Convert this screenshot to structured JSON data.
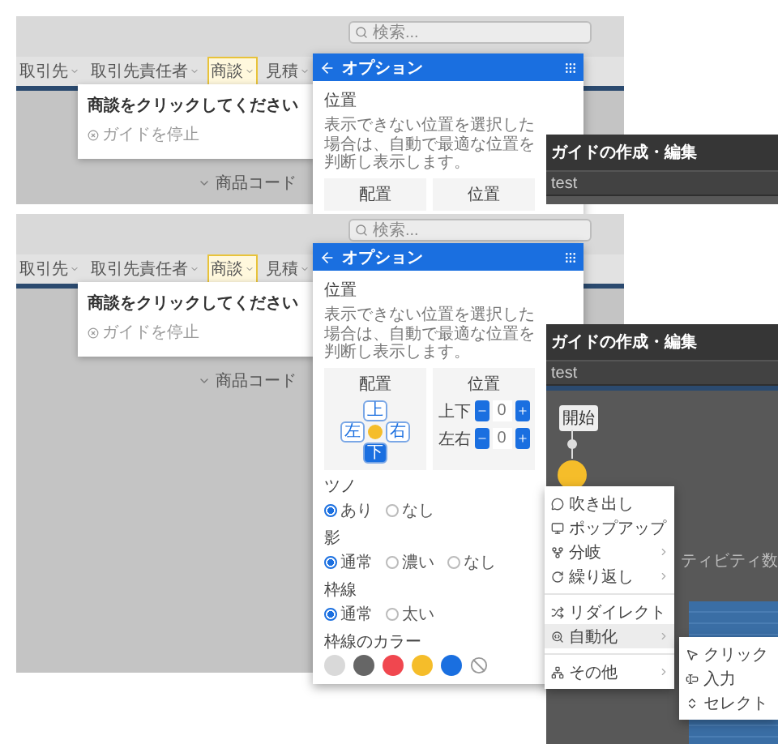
{
  "screens": [
    {
      "search": {
        "placeholder": "検索..."
      },
      "nav": [
        {
          "label": "取引先",
          "selected": false
        },
        {
          "label": "取引先責任者",
          "selected": false
        },
        {
          "label": "商談",
          "selected": true
        },
        {
          "label": "見積",
          "selected": false
        }
      ],
      "tooltip": {
        "title": "商談をクリックしてください",
        "stop_link": "ガイドを停止"
      },
      "column_header": "商品コード",
      "options": {
        "title": "オプション",
        "position": {
          "title": "位置",
          "description": "表示できない位置を選択した場合は、自動で最適な位置を判断し表示します。",
          "placement_label": "配置",
          "offset_label": "位置"
        }
      },
      "guide_panel": {
        "title": "ガイドの作成・編集",
        "name": "test"
      }
    },
    {
      "search": {
        "placeholder": "検索..."
      },
      "nav": [
        {
          "label": "取引先",
          "selected": false
        },
        {
          "label": "取引先責任者",
          "selected": false
        },
        {
          "label": "商談",
          "selected": true
        },
        {
          "label": "見積",
          "selected": false
        }
      ],
      "tooltip": {
        "title": "商談をクリックしてください",
        "stop_link": "ガイドを停止"
      },
      "column_header": "商品コード",
      "options": {
        "title": "オプション",
        "position": {
          "title": "位置",
          "description": "表示できない位置を選択した場合は、自動で最適な位置を判断し表示します。",
          "placement_label": "配置",
          "offset_label": "位置",
          "placement": [
            {
              "kind": "top",
              "label": "上",
              "selected": false
            },
            {
              "kind": "left",
              "label": "左",
              "selected": false
            },
            {
              "kind": "right",
              "label": "右",
              "selected": false
            },
            {
              "kind": "bottom",
              "label": "下",
              "selected": true
            }
          ],
          "offsets": [
            {
              "label": "上下",
              "value": "0"
            },
            {
              "label": "左右",
              "value": "0"
            }
          ]
        },
        "radio_groups": [
          {
            "title": "ツノ",
            "options": [
              {
                "label": "あり",
                "selected": true
              },
              {
                "label": "なし",
                "selected": false
              }
            ]
          },
          {
            "title": "影",
            "options": [
              {
                "label": "通常",
                "selected": true
              },
              {
                "label": "濃い",
                "selected": false
              },
              {
                "label": "なし",
                "selected": false
              }
            ]
          },
          {
            "title": "枠線",
            "options": [
              {
                "label": "通常",
                "selected": true
              },
              {
                "label": "太い",
                "selected": false
              }
            ]
          }
        ],
        "border_color": {
          "title": "枠線のカラー",
          "swatches": [
            {
              "kind": "color",
              "color": "#d9d9d9"
            },
            {
              "kind": "color",
              "color": "#666666"
            },
            {
              "kind": "color",
              "color": "#f0474f"
            },
            {
              "kind": "color",
              "color": "#f5bd2a"
            },
            {
              "kind": "color",
              "color": "#1a6fe0"
            },
            {
              "kind": "none"
            }
          ]
        }
      },
      "guide_panel": {
        "title": "ガイドの作成・編集",
        "name": "test",
        "start_label": "開始",
        "background_text": "ティビティ数"
      },
      "menu": {
        "groups": [
          [
            {
              "kind": "bubble",
              "label": "吹き出し",
              "submenu": false,
              "selected": false
            },
            {
              "kind": "popup",
              "label": "ポップアップ",
              "submenu": false,
              "selected": false
            },
            {
              "kind": "branch",
              "label": "分岐",
              "submenu": true,
              "selected": false
            },
            {
              "kind": "loop",
              "label": "繰り返し",
              "submenu": true,
              "selected": false
            }
          ],
          [
            {
              "kind": "redirect",
              "label": "リダイレクト",
              "submenu": false,
              "selected": false
            },
            {
              "kind": "automation",
              "label": "自動化",
              "submenu": true,
              "selected": true
            }
          ],
          [
            {
              "kind": "other",
              "label": "その他",
              "submenu": true,
              "selected": false
            }
          ]
        ]
      },
      "submenu": [
        {
          "kind": "click",
          "label": "クリック"
        },
        {
          "kind": "input",
          "label": "入力"
        },
        {
          "kind": "select",
          "label": "セレクト"
        }
      ]
    }
  ]
}
